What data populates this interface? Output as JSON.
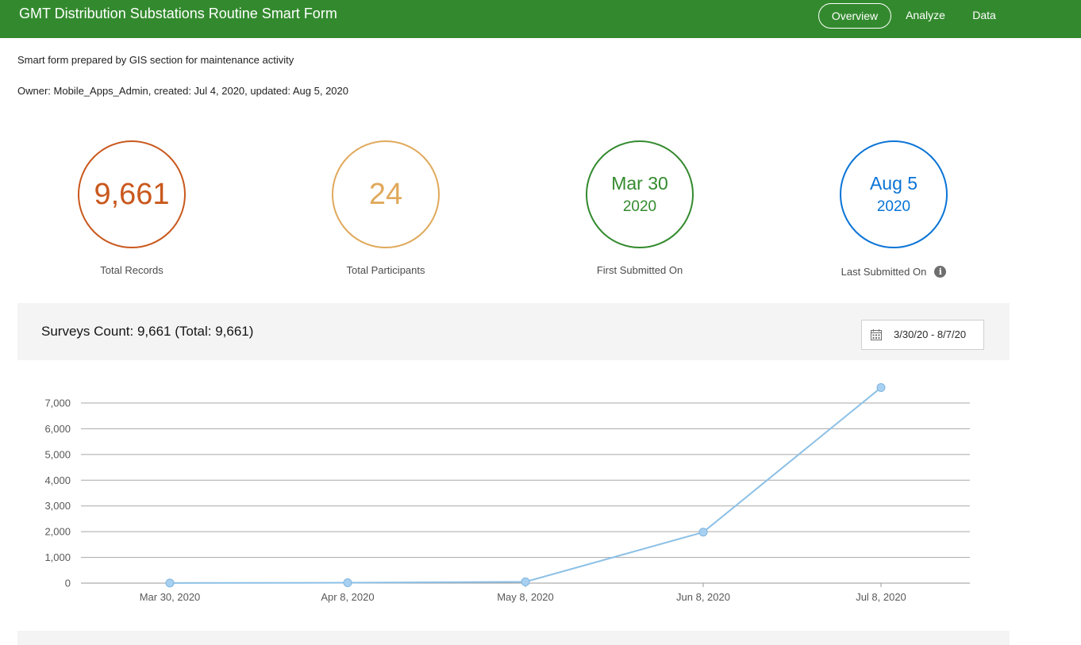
{
  "header": {
    "title": "GMT Distribution Substations Routine Smart Form",
    "nav": [
      "Overview",
      "Analyze",
      "Data"
    ],
    "active_nav": "Overview"
  },
  "description": "Smart form prepared by GIS section for maintenance activity",
  "owner_line": "Owner: Mobile_Apps_Admin, created: Jul 4, 2020, updated: Aug 5, 2020",
  "stats": {
    "total_records": {
      "value": "9,661",
      "label": "Total Records",
      "color": "#c9581d"
    },
    "total_participants": {
      "value": "24",
      "label": "Total Participants",
      "color": "#e0a95b"
    },
    "first_submitted": {
      "line1": "Mar 30",
      "line2": "2020",
      "label": "First Submitted On",
      "color": "#338a2e"
    },
    "last_submitted": {
      "line1": "Aug 5",
      "line2": "2020",
      "label": "Last Submitted On",
      "color": "#0a74d6",
      "info_icon": "info-icon"
    }
  },
  "surveys": {
    "title": "Surveys Count: 9,661 (Total: 9,661)",
    "date_range": "3/30/20 - 8/7/20",
    "date_icon": "calendar-icon"
  },
  "chart_data": {
    "type": "line",
    "categories": [
      "Mar 30, 2020",
      "Apr 8, 2020",
      "May 8, 2020",
      "Jun 8, 2020",
      "Jul 8, 2020"
    ],
    "values": [
      5,
      15,
      50,
      1980,
      7600
    ],
    "yticks": [
      "0",
      "1,000",
      "2,000",
      "3,000",
      "4,000",
      "5,000",
      "6,000",
      "7,000"
    ],
    "ylim": [
      0,
      7000
    ],
    "grid": true,
    "line_color": "#8cc0e6",
    "marker_color": "#a8d0f0"
  }
}
